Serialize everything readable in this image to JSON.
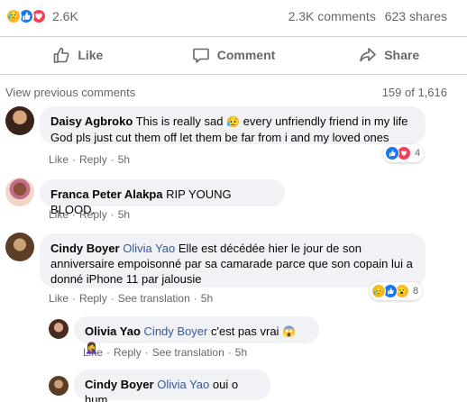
{
  "stats": {
    "reaction_count": "2.6K",
    "comments": "2.3K comments",
    "shares": "623 shares"
  },
  "actions": {
    "like": "Like",
    "comment": "Comment",
    "share": "Share"
  },
  "view_previous": "View previous comments",
  "page_count": "159 of 1,616",
  "comments": [
    {
      "author": "Daisy Agbroko",
      "text_before": "This is really sad",
      "emoji": "😥",
      "text_after": "every unfriendly friend in my life God pls just cut them off let them be far from i and my loved ones",
      "like": "Like",
      "reply": "Reply",
      "time": "5h",
      "reaction_count": "4"
    },
    {
      "author": "Franca Peter Alakpa",
      "text": "RIP YOUNG BLOOD.",
      "like": "Like",
      "reply": "Reply",
      "time": "5h"
    },
    {
      "author": "Cindy Boyer",
      "tag": "Olivia Yao",
      "text": "Elle est décédée hier le jour de son anniversaire empoisonné par sa camarade parce que son copain lui a donné iPhone 11 par jalousie",
      "like": "Like",
      "reply": "Reply",
      "see_translation": "See translation",
      "time": "5h",
      "reaction_count": "8"
    },
    {
      "author": "Olivia Yao",
      "tag": "Cindy Boyer",
      "text": "c'est pas vrai",
      "emoji": "😱🤦‍♀️",
      "like": "Like",
      "reply": "Reply",
      "see_translation": "See translation",
      "time": "5h"
    },
    {
      "author": "Cindy Boyer",
      "tag": "Olivia Yao",
      "text": "oui o hum"
    }
  ],
  "colors": {
    "like_blue": "#1877f2",
    "love_red": "#f33e58",
    "sad_yellow": "#f7b928",
    "tag_blue": "#385898",
    "bubble_bg": "#f0f2f5",
    "meta_gray": "#65676b"
  }
}
